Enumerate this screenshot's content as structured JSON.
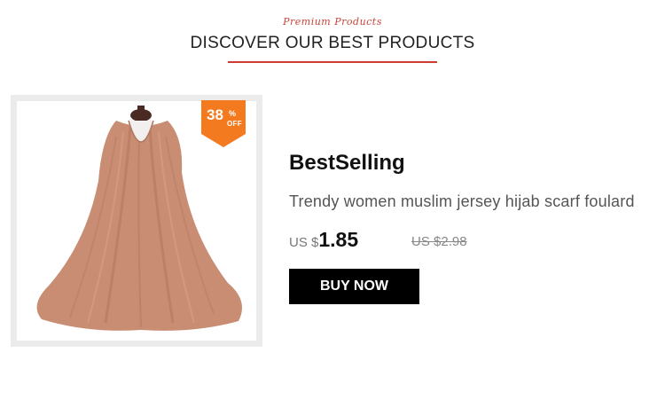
{
  "header": {
    "subtitle": "Premium Products",
    "title": "DISCOVER OUR BEST PRODUCTS"
  },
  "product": {
    "badge_value": "38",
    "badge_percent": "%",
    "badge_off": "OFF",
    "heading": "BestSelling",
    "description": "Trendy women muslim jersey hijab scarf foulard",
    "currency": "US $",
    "price": "1.85",
    "old_price": "US $2.98",
    "buy_label": "BUY NOW",
    "image_icon": "scarf-on-mannequin-image",
    "colors": {
      "scarf": "#c98d73",
      "badge": "#f47a1f",
      "accent_line": "#cf3b2e",
      "button": "#000000"
    }
  }
}
